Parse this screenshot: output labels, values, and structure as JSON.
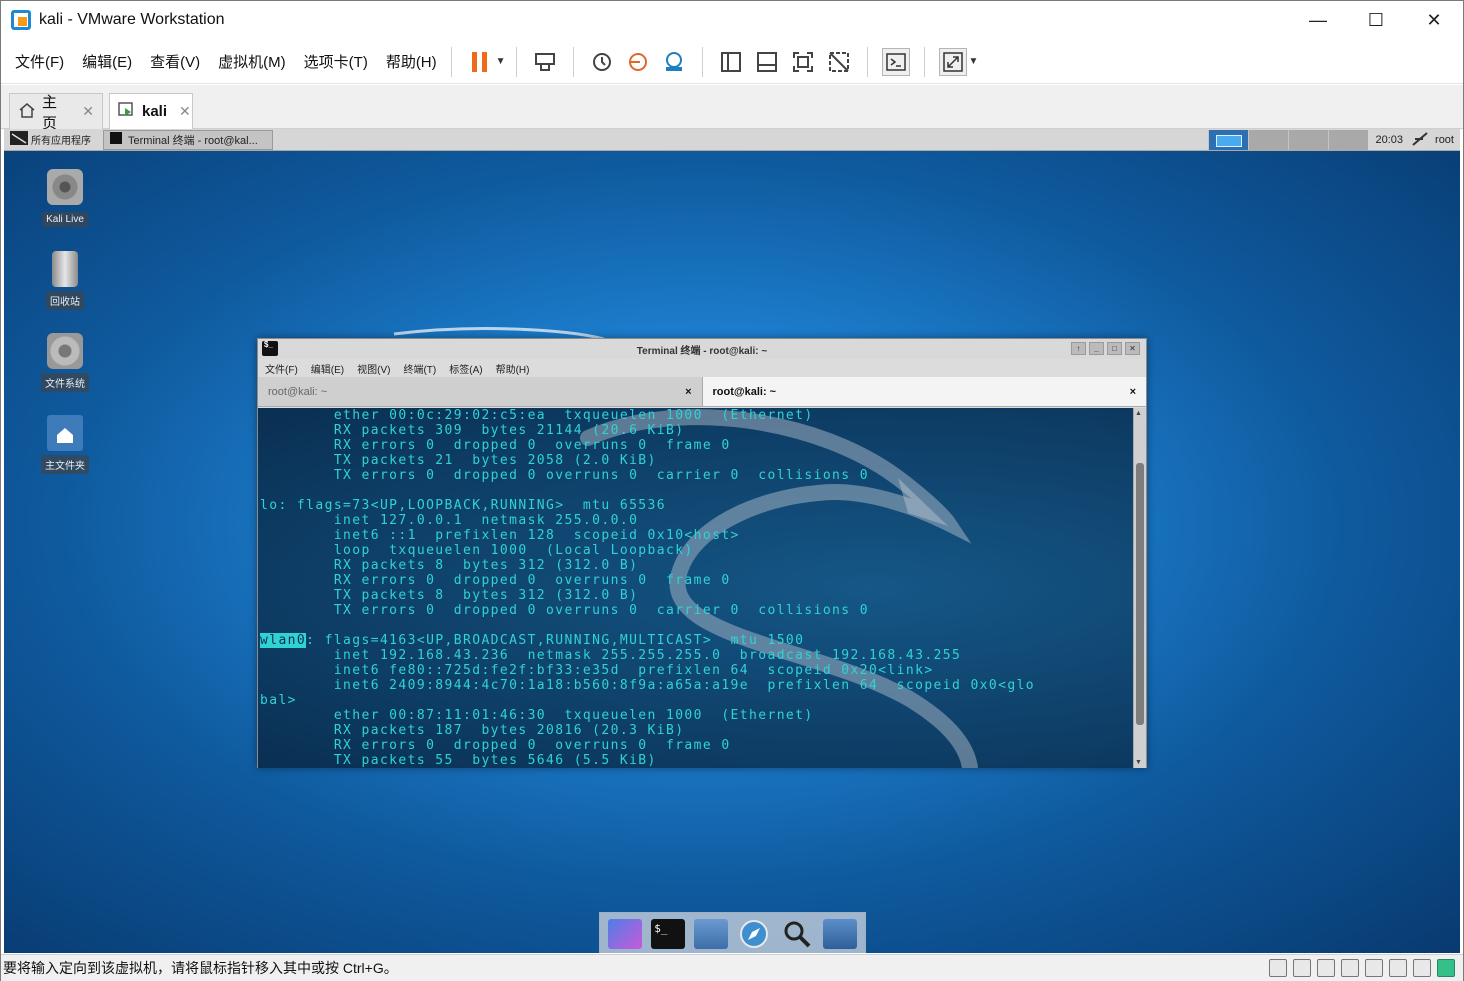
{
  "window": {
    "title": "kali - VMware Workstation",
    "controls": {
      "minimize": "—",
      "maximize": "☐",
      "close": "✕"
    }
  },
  "menubar": {
    "items": [
      "文件(F)",
      "编辑(E)",
      "查看(V)",
      "虚拟机(M)",
      "选项卡(T)",
      "帮助(H)"
    ],
    "toolbar_icons": [
      "pause-icon",
      "send-ctrl-alt-del-icon",
      "snapshot-icon",
      "revert-snapshot-icon",
      "manage-snapshots-icon",
      "library-icon",
      "thumbnail-icon",
      "fullscreen-icon",
      "unity-icon",
      "console-icon",
      "stretch-icon"
    ]
  },
  "tabs": [
    {
      "label": "主页",
      "icon": "home-icon"
    },
    {
      "label": "kali",
      "icon": "vm-icon",
      "active": true
    }
  ],
  "guest": {
    "panel": {
      "apps_label": "所有应用程序",
      "task_label": "Terminal 终端 - root@kal...",
      "clock": "20:03",
      "user": "root"
    },
    "desktop_icons": [
      {
        "label": "Kali Live",
        "icon": "disc-icon"
      },
      {
        "label": "回收站",
        "icon": "trash-icon"
      },
      {
        "label": "文件系统",
        "icon": "drive-icon"
      },
      {
        "label": "主文件夹",
        "icon": "home-folder-icon"
      }
    ],
    "terminal": {
      "title": "Terminal 终端 - root@kali: ~",
      "menu": [
        "文件(F)",
        "编辑(E)",
        "视图(V)",
        "终端(T)",
        "标签(A)",
        "帮助(H)"
      ],
      "tabs": [
        {
          "label": "root@kali: ~",
          "close": "×"
        },
        {
          "label": "root@kali: ~",
          "close": "×",
          "active": true
        }
      ],
      "lines_top": [
        "        ether 00:0c:29:02:c5:ea  txqueuelen 1000  (Ethernet)",
        "        RX packets 309  bytes 21144 (20.6 KiB)",
        "        RX errors 0  dropped 0  overruns 0  frame 0",
        "        TX packets 21  bytes 2058 (2.0 KiB)",
        "        TX errors 0  dropped 0 overruns 0  carrier 0  collisions 0",
        "",
        "lo: flags=73<UP,LOOPBACK,RUNNING>  mtu 65536",
        "        inet 127.0.0.1  netmask 255.0.0.0",
        "        inet6 ::1  prefixlen 128  scopeid 0x10<host>",
        "        loop  txqueuelen 1000  (Local Loopback)",
        "        RX packets 8  bytes 312 (312.0 B)",
        "        RX errors 0  dropped 0  overruns 0  frame 0",
        "        TX packets 8  bytes 312 (312.0 B)",
        "        TX errors 0  dropped 0 overruns 0  carrier 0  collisions 0",
        ""
      ],
      "wlan_name": "wlan0",
      "wlan_flags": ": flags=4163<UP,BROADCAST,RUNNING,MULTICAST>  mtu 1500",
      "lines_bottom": [
        "        inet 192.168.43.236  netmask 255.255.255.0  broadcast 192.168.43.255",
        "        inet6 fe80::725d:fe2f:bf33:e35d  prefixlen 64  scopeid 0x20<link>",
        "        inet6 2409:8944:4c70:1a18:b560:8f9a:a65a:a19e  prefixlen 64  scopeid 0x0<glo",
        "bal>",
        "        ether 00:87:11:01:46:30  txqueuelen 1000  (Ethernet)",
        "        RX packets 187  bytes 20816 (20.3 KiB)",
        "        RX errors 0  dropped 0  overruns 0  frame 0",
        "        TX packets 55  bytes 5646 (5.5 KiB)"
      ]
    },
    "dock_icons": [
      "desktop-icon",
      "terminal-icon",
      "files-icon",
      "browser-icon",
      "search-icon",
      "folder-icon"
    ]
  },
  "statusbar": {
    "message": "要将输入定向到该虚拟机，请将鼠标指针移入其中或按 Ctrl+G。"
  },
  "colors": {
    "accent": "#1e88d8",
    "terminal_text": "#2fd3d3",
    "desktop_bg": "#1d7fcf"
  }
}
